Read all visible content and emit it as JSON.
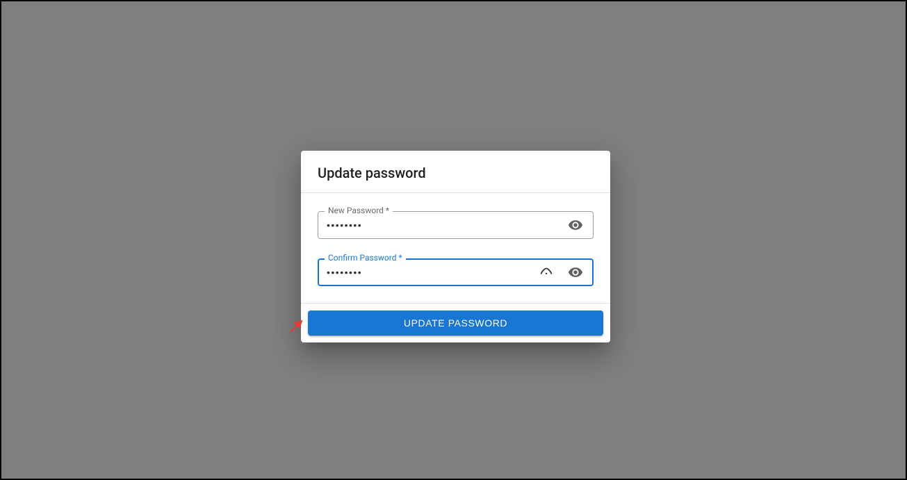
{
  "colors": {
    "primary": "#1976d2",
    "arrow": "#e53935"
  },
  "dialog": {
    "title": "Update password",
    "new_password": {
      "label": "New Password *",
      "value": "••••••••"
    },
    "confirm_password": {
      "label": "Confirm Password *",
      "value": "••••••••"
    },
    "button_label": "Update Password"
  }
}
